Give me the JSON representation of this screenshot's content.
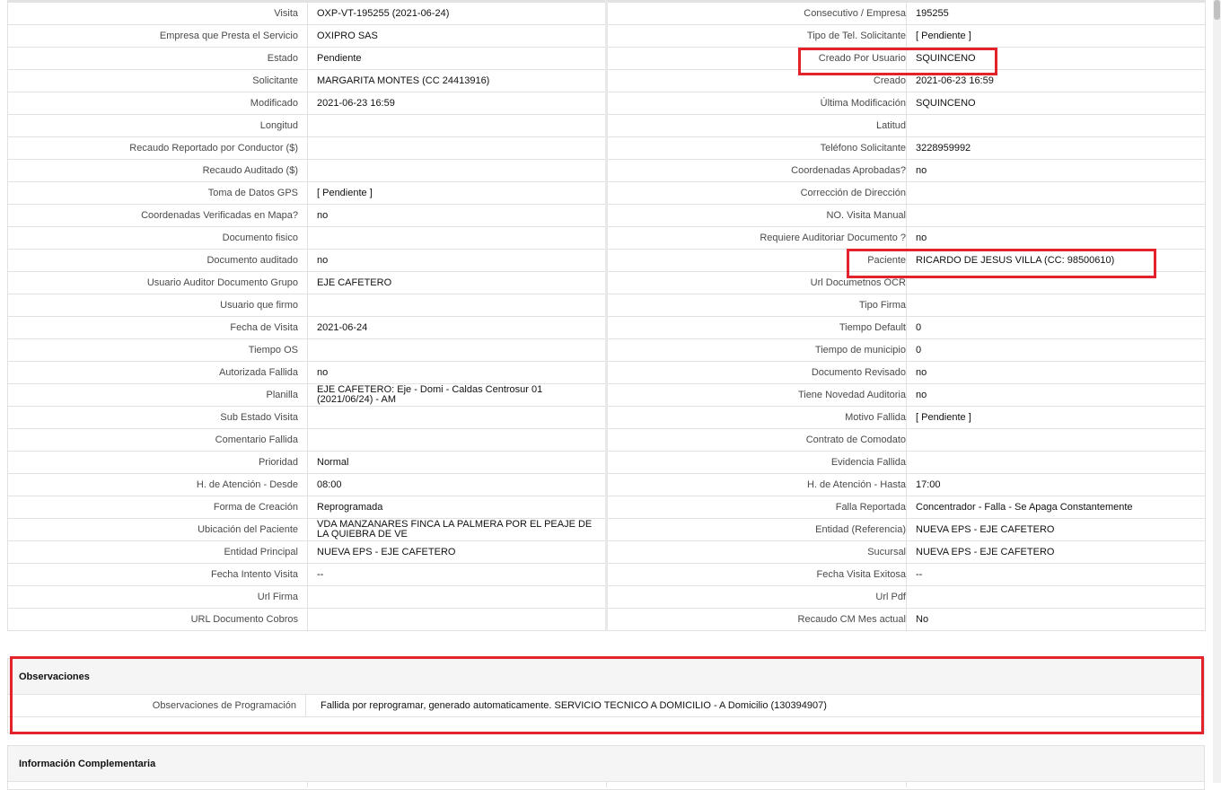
{
  "rows": [
    {
      "l1": "Visita",
      "v1": "OXP-VT-195255 (2021-06-24)",
      "l2": "Consecutivo / Empresa",
      "v2": "195255"
    },
    {
      "l1": "Empresa que Presta el Servicio",
      "v1": "OXIPRO SAS",
      "l2": "Tipo de Tel. Solicitante",
      "v2": "[ Pendiente ]"
    },
    {
      "l1": "Estado",
      "v1": "Pendiente",
      "l2": "Creado Por Usuario",
      "v2": "SQUINCENO"
    },
    {
      "l1": "Solicitante",
      "v1": "MARGARITA MONTES (CC 24413916)",
      "l2": "Creado",
      "v2": "2021-06-23 16:59"
    },
    {
      "l1": "Modificado",
      "v1": "2021-06-23 16:59",
      "l2": "Última Modificación",
      "v2": " SQUINCENO"
    },
    {
      "l1": "Longitud",
      "v1": "",
      "l2": "Latitud",
      "v2": ""
    },
    {
      "l1": "Recaudo Reportado por Conductor ($)",
      "v1": "",
      "l2": "Teléfono Solicitante",
      "v2": "3228959992"
    },
    {
      "l1": "Recaudo Auditado ($)",
      "v1": "",
      "l2": "Coordenadas Aprobadas?",
      "v2": " no"
    },
    {
      "l1": "Toma de Datos GPS",
      "v1": "[ Pendiente ]",
      "l2": "Corrección de Dirección",
      "v2": ""
    },
    {
      "l1": "Coordenadas Verificadas en Mapa?",
      "v1": " no",
      "l2": "NO. Visita Manual",
      "v2": ""
    },
    {
      "l1": "Documento fisico",
      "v1": "",
      "l2": "Requiere Auditoriar Documento ?",
      "v2": " no"
    },
    {
      "l1": "Documento auditado",
      "v1": " no",
      "l2": "Paciente",
      "v2": "RICARDO DE JESUS VILLA (CC: 98500610)"
    },
    {
      "l1": "Usuario Auditor Documento Grupo",
      "v1": "EJE CAFETERO",
      "l2": "Url Documetnos OCR",
      "v2": ""
    },
    {
      "l1": "Usuario que firmo",
      "v1": "",
      "l2": "Tipo Firma",
      "v2": ""
    },
    {
      "l1": "Fecha de Visita",
      "v1": " 2021-06-24",
      "l2": "Tiempo Default",
      "v2": "0"
    },
    {
      "l1": "Tiempo OS",
      "v1": "",
      "l2": "Tiempo de municipio",
      "v2": "0"
    },
    {
      "l1": "Autorizada Fallida",
      "v1": " no",
      "l2": "Documento Revisado",
      "v2": " no"
    },
    {
      "l1": "Planilla",
      "v1": "EJE CAFETERO: Eje - Domi - Caldas Centrosur 01 (2021/06/24) - AM",
      "l2": "Tiene Novedad Auditoria",
      "v2": " no"
    },
    {
      "l1": "Sub Estado Visita",
      "v1": "",
      "l2": "Motivo Fallida",
      "v2": "[ Pendiente ]"
    },
    {
      "l1": "Comentario Fallida",
      "v1": "",
      "l2": "Contrato de Comodato",
      "v2": ""
    },
    {
      "l1": "Prioridad",
      "v1": "Normal",
      "l2": "Evidencia Fallida",
      "v2": ""
    },
    {
      "l1": "H. de Atención - Desde",
      "v1": "08:00",
      "l2": "H. de Atención - Hasta",
      "v2": "17:00"
    },
    {
      "l1": "Forma de Creación",
      "v1": "Reprogramada",
      "l2": "Falla Reportada",
      "v2": "Concentrador - Falla - Se Apaga Constantemente"
    },
    {
      "l1": "Ubicación del Paciente",
      "v1": "VDA MANZANARES FINCA LA PALMERA POR EL PEAJE DE LA QUIEBRA DE VE",
      "l2": "Entidad (Referencia)",
      "v2": "NUEVA EPS - EJE CAFETERO"
    },
    {
      "l1": "Entidad Principal",
      "v1": "NUEVA EPS - EJE CAFETERO",
      "l2": "Sucursal",
      "v2": "NUEVA EPS - EJE CAFETERO"
    },
    {
      "l1": "Fecha Intento Visita",
      "v1": " --",
      "l2": "Fecha Visita Exitosa",
      "v2": " --"
    },
    {
      "l1": "Url Firma",
      "v1": "",
      "l2": "Url Pdf",
      "v2": ""
    },
    {
      "l1": "URL Documento Cobros",
      "v1": "",
      "l2": "Recaudo CM Mes actual",
      "v2": "No"
    }
  ],
  "observaciones": {
    "title": "Observaciones",
    "label": "Observaciones de Programación",
    "value": "Fallida por reprogramar, generado automaticamente. SERVICIO TECNICO A DOMICILIO - A Domicilio (130394907)"
  },
  "complementaria": {
    "title": "Información Complementaria"
  },
  "colors": {
    "highlight": "#e3222b",
    "border": "#e1e1e1",
    "label_text": "#4a4a4a"
  }
}
